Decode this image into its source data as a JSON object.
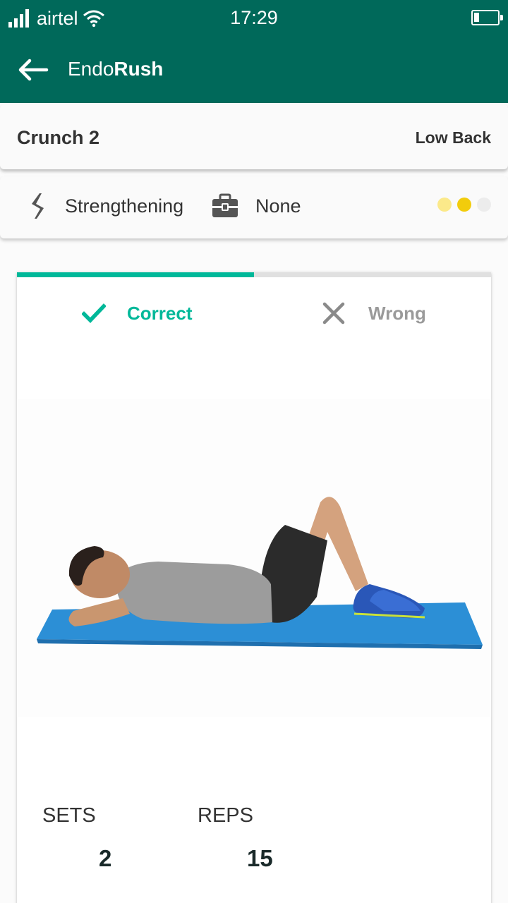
{
  "status_bar": {
    "carrier": "airtel",
    "time": "17:29",
    "battery_level": 0.2
  },
  "app_bar": {
    "title_prefix": "Endo",
    "title_bold": "Rush",
    "back_icon": "arrow-left-icon"
  },
  "exercise": {
    "name": "Crunch 2",
    "area": "Low Back"
  },
  "info": {
    "type_icon": "lightning-icon",
    "type": "Strengthening",
    "equipment_icon": "toolbox-icon",
    "equipment": "None",
    "difficulty": 2,
    "difficulty_max": 3
  },
  "tabs": {
    "correct": "Correct",
    "wrong": "Wrong",
    "progress": 0.5
  },
  "stats": {
    "sets_label": "SETS",
    "sets_value": "2",
    "reps_label": "REPS",
    "reps_value": "15"
  },
  "colors": {
    "primary": "#00695a",
    "accent": "#00b899",
    "dot_active": "#f2cc0c",
    "dot_light": "#fbe98a",
    "dot_inactive": "#ececec",
    "mat": "#2c8fd6"
  }
}
